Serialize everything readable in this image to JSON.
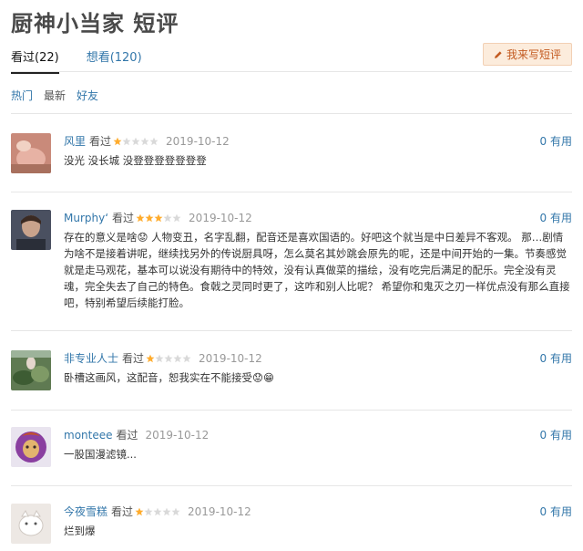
{
  "header": {
    "title": "厨神小当家 短评",
    "write_label": "我来写短评"
  },
  "tabs": [
    {
      "label": "看过(22)",
      "active": true
    },
    {
      "label": "想看(120)",
      "active": false
    }
  ],
  "sort": [
    {
      "label": "热门",
      "active": true
    },
    {
      "label": "最新",
      "active": false
    },
    {
      "label": "好友",
      "active": true
    }
  ],
  "colors": {
    "link": "#3377aa",
    "star": "#ffac2d",
    "star_empty": "#d9d9d9",
    "write_bg": "#fcecdc",
    "write_text": "#c35a20"
  },
  "comments": [
    {
      "user": "风里",
      "seen": "看过",
      "rating": 1,
      "date": "2019-10-12",
      "useful": "0 有用",
      "text": "没光 没长城 没登登登登登登登",
      "avatar": "avatar-photo-pink"
    },
    {
      "user": "Murphy‘",
      "seen": "看过",
      "rating": 3,
      "date": "2019-10-12",
      "useful": "0 有用",
      "text": "存在的意义是啥😟 人物变丑，名字乱翻，配音还是喜欢国语的。好吧这个就当是中日差异不客观。 那…剧情为啥不是接着讲呢，继续找另外的传说厨具呀，怎么莫名其妙跳会原先的呢，还是中间开始的一集。节奏感觉就是走马观花，基本可以说没有期待中的特效，没有认真做菜的描绘，没有吃完后满足的配乐。完全没有灵魂，完全失去了自己的特色。食戟之灵同时更了，这咋和别人比呢？ 希望你和鬼灭之刃一样优点没有那么直接吧，特别希望后续能打脸。",
      "avatar": "avatar-photo-man"
    },
    {
      "user": "非专业人士",
      "seen": "看过",
      "rating": 1,
      "date": "2019-10-12",
      "useful": "0 有用",
      "text": "卧槽这画风，这配音，恕我实在不能接受😟😁",
      "avatar": "avatar-photo-lotus"
    },
    {
      "user": "monteee",
      "seen": "看过",
      "rating": 0,
      "date": "2019-10-12",
      "useful": "0 有用",
      "text": "一股国漫滤镜...",
      "avatar": "avatar-illustration-purple"
    },
    {
      "user": "今夜雪糕",
      "seen": "看过",
      "rating": 1,
      "date": "2019-10-12",
      "useful": "0 有用",
      "text": "烂到爆",
      "avatar": "avatar-photo-white"
    }
  ]
}
